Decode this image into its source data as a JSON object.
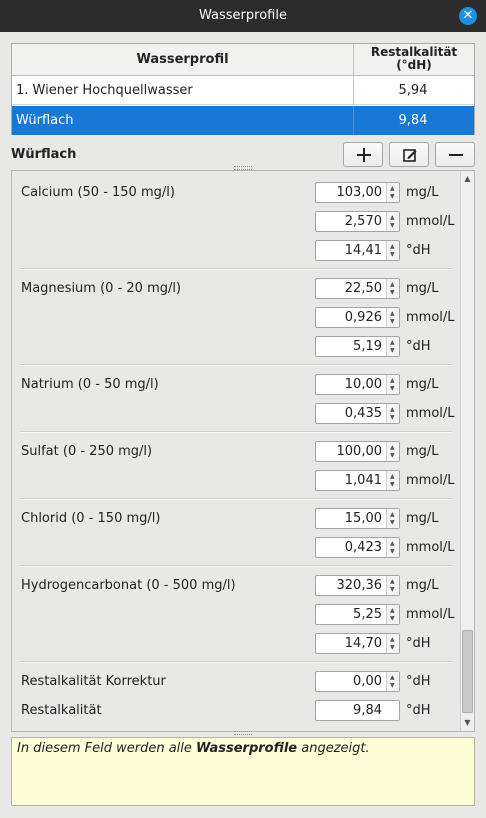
{
  "window": {
    "title": "Wasserprofile"
  },
  "icons": {
    "close": "close-icon",
    "add": "plus-icon",
    "edit": "edit-icon",
    "remove": "minus-icon"
  },
  "colors": {
    "selection": "#1778d6",
    "hint_bg": "#fdfdd8",
    "close_button": "#1f8fe0"
  },
  "table": {
    "headers": [
      "Wasserprofil",
      "Restalkalität (°dH)"
    ],
    "rows": [
      {
        "name": "1. Wiener Hochquellwasser",
        "value": "5,94",
        "selected": false
      },
      {
        "name": "Würflach",
        "value": "9,84",
        "selected": true
      }
    ]
  },
  "details": {
    "profile_name": "Würflach",
    "groups": [
      {
        "label": "Calcium (50 - 150 mg/l)",
        "fields": [
          {
            "value": "103,00",
            "unit": "mg/L"
          },
          {
            "value": "2,570",
            "unit": "mmol/L"
          },
          {
            "value": "14,41",
            "unit": "°dH"
          }
        ]
      },
      {
        "label": "Magnesium (0 - 20 mg/l)",
        "fields": [
          {
            "value": "22,50",
            "unit": "mg/L"
          },
          {
            "value": "0,926",
            "unit": "mmol/L"
          },
          {
            "value": "5,19",
            "unit": "°dH"
          }
        ]
      },
      {
        "label": "Natrium (0 - 50 mg/l)",
        "fields": [
          {
            "value": "10,00",
            "unit": "mg/L"
          },
          {
            "value": "0,435",
            "unit": "mmol/L"
          }
        ]
      },
      {
        "label": "Sulfat (0 - 250 mg/l)",
        "fields": [
          {
            "value": "100,00",
            "unit": "mg/L"
          },
          {
            "value": "1,041",
            "unit": "mmol/L"
          }
        ]
      },
      {
        "label": "Chlorid (0 - 150 mg/l)",
        "fields": [
          {
            "value": "15,00",
            "unit": "mg/L"
          },
          {
            "value": "0,423",
            "unit": "mmol/L"
          }
        ]
      },
      {
        "label": "Hydrogencarbonat (0 - 500 mg/l)",
        "fields": [
          {
            "value": "320,36",
            "unit": "mg/L"
          },
          {
            "value": "5,25",
            "unit": "mmol/L"
          },
          {
            "value": "14,70",
            "unit": "°dH"
          }
        ]
      }
    ],
    "correction": {
      "label": "Restalkalität Korrektur",
      "value": "0,00",
      "unit": "°dH"
    },
    "result": {
      "label": "Restalkalität",
      "value": "9,84",
      "unit": "°dH"
    }
  },
  "hint": {
    "prefix": "In diesem Feld werden alle ",
    "bold": "Wasserprofile",
    "suffix": " angezeigt."
  }
}
